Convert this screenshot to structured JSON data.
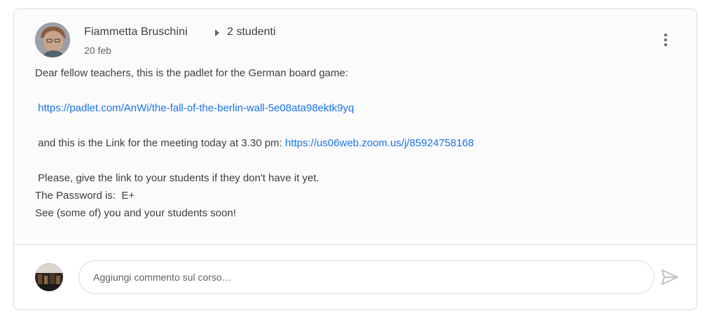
{
  "post": {
    "author": "Fiammetta Bruschini",
    "audience": "2 studenti",
    "date": "20 feb",
    "lines": {
      "intro": "Dear fellow teachers, this is the padlet for the German board game:",
      "padlet_link": "https://padlet.com/AnWi/the-fall-of-the-berlin-wall-5e08ata98ektk9yq",
      "meeting_text": " and this is the Link for the meeting today at 3.30 pm: ",
      "zoom_link": "https://us06web.zoom.us/j/85924758168",
      "please": " Please, give the link to your students if they don't have it yet.",
      "password": "The Password is:  E+",
      "see_you": "See (some of) you and your students soon!"
    }
  },
  "comment": {
    "placeholder": "Aggiungi commento sul corso…"
  },
  "colors": {
    "link": "#1a73e8",
    "text": "#3c4043",
    "muted": "#5f6368",
    "border": "#dadce0"
  }
}
